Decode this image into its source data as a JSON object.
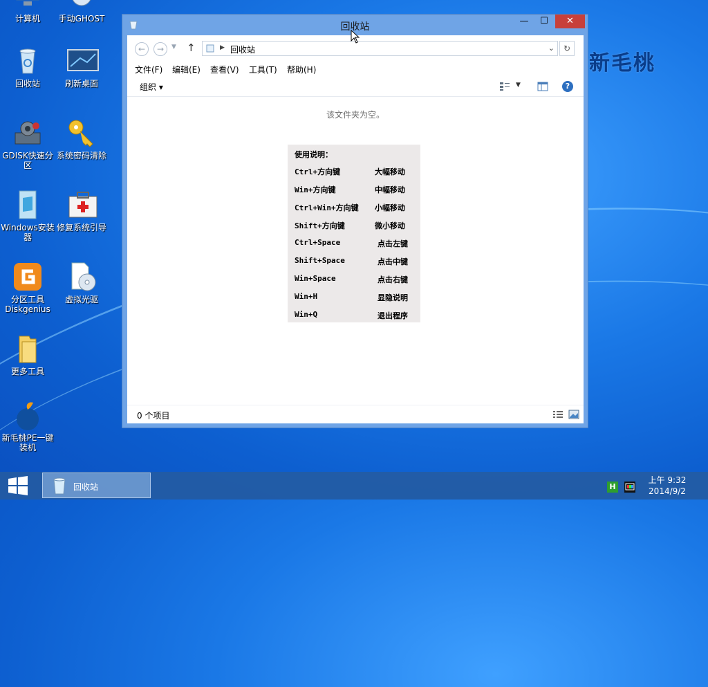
{
  "brand": "新毛桃",
  "desktop_icons": [
    {
      "label": "计算机"
    },
    {
      "label": "手动GHOST"
    },
    {
      "label": "回收站"
    },
    {
      "label": "刷新桌面"
    },
    {
      "label": "GDISK快速分区"
    },
    {
      "label": "系统密码清除"
    },
    {
      "label": "Windows安装器"
    },
    {
      "label": "修复系统引导"
    },
    {
      "label": "分区工具Diskgenius"
    },
    {
      "label": "虚拟光驱"
    },
    {
      "label": "更多工具"
    },
    {
      "label": "新毛桃PE一键装机"
    }
  ],
  "window": {
    "title": "回收站",
    "min_glyph": "—",
    "max_glyph": "☐",
    "close_glyph": "✕",
    "address": "回收站",
    "menu": [
      "文件(F)",
      "编辑(E)",
      "查看(V)",
      "工具(T)",
      "帮助(H)"
    ],
    "organize": "组织 ▾",
    "empty_text": "该文件夹为空。",
    "status": "0 个项目"
  },
  "help": {
    "heading": "使用说明：",
    "rows": [
      {
        "key": "Ctrl+方向键",
        "value": "大幅移动"
      },
      {
        "key": "Win+方向键",
        "value": "中幅移动"
      },
      {
        "key": "Ctrl+Win+方向键",
        "value": "小幅移动"
      },
      {
        "key": "Shift+方向键",
        "value": "微小移动"
      },
      {
        "key": "Ctrl+Space",
        "value": "点击左键"
      },
      {
        "key": "Shift+Space",
        "value": "点击中键"
      },
      {
        "key": "Win+Space",
        "value": "点击右键"
      },
      {
        "key": "Win+H",
        "value": "显隐说明"
      },
      {
        "key": "Win+Q",
        "value": "退出程序"
      }
    ]
  },
  "taskbar": {
    "item": "回收站",
    "tray_h": "H",
    "time": "上午 9:32",
    "date": "2014/9/2"
  },
  "colors": {
    "close_button": "#c7403a",
    "window_frame": "#6fa4e6",
    "help_bg": "#ece9e9"
  }
}
